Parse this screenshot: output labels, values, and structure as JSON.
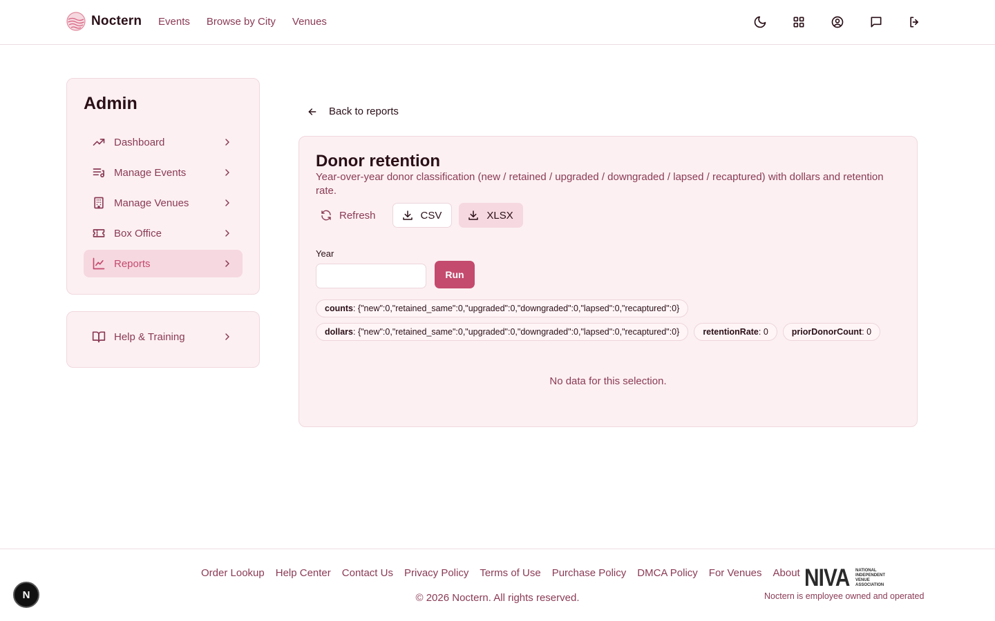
{
  "app": {
    "brand": "Noctern",
    "nav": [
      "Events",
      "Browse by City",
      "Venues"
    ],
    "header_icons": [
      "moon-icon",
      "grid-icon",
      "user-circle-icon",
      "message-icon",
      "logout-icon"
    ]
  },
  "sidebar": {
    "title": "Admin",
    "items": [
      {
        "label": "Dashboard",
        "icon": "trending-up-icon",
        "active": false
      },
      {
        "label": "Manage Events",
        "icon": "list-music-icon",
        "active": false
      },
      {
        "label": "Manage Venues",
        "icon": "building-icon",
        "active": false
      },
      {
        "label": "Box Office",
        "icon": "ticket-icon",
        "active": false
      },
      {
        "label": "Reports",
        "icon": "line-chart-icon",
        "active": true
      }
    ],
    "help": {
      "label": "Help & Training",
      "icon": "book-open-icon"
    }
  },
  "report": {
    "back_label": "Back to reports",
    "title": "Donor retention",
    "description": "Year-over-year donor classification (new / retained / upgraded / downgraded / lapsed / recaptured) with dollars and retention rate.",
    "buttons": {
      "refresh": "Refresh",
      "csv": "CSV",
      "xlsx": "XLSX"
    },
    "year_label": "Year",
    "year_value": "",
    "run_label": "Run",
    "chips": {
      "counts_key": "counts",
      "counts_value": ": {\"new\":0,\"retained_same\":0,\"upgraded\":0,\"downgraded\":0,\"lapsed\":0,\"recaptured\":0}",
      "dollars_key": "dollars",
      "dollars_value": ": {\"new\":0,\"retained_same\":0,\"upgraded\":0,\"downgraded\":0,\"lapsed\":0,\"recaptured\":0}",
      "retention_key": "retentionRate",
      "retention_value": ": 0",
      "prior_key": "priorDonorCount",
      "prior_value": ": 0"
    },
    "empty_message": "No data for this selection."
  },
  "footer": {
    "links": [
      "Order Lookup",
      "Help Center",
      "Contact Us",
      "Privacy Policy",
      "Terms of Use",
      "Purchase Policy",
      "DMCA Policy",
      "For Venues",
      "About"
    ],
    "copyright": "© 2026 Noctern. All rights reserved.",
    "niva_logo": "NIVA",
    "niva_subtitle": [
      "NATIONAL",
      "INDEPENDENT",
      "VENUE",
      "ASSOCIATION"
    ],
    "employee_note": "Noctern is employee owned and operated"
  },
  "badge": "N",
  "colors": {
    "accent": "#c44a6e",
    "text_muted": "#8a3a55",
    "panel_bg": "#fcf0f2",
    "active_bg": "#f6d8e0"
  }
}
